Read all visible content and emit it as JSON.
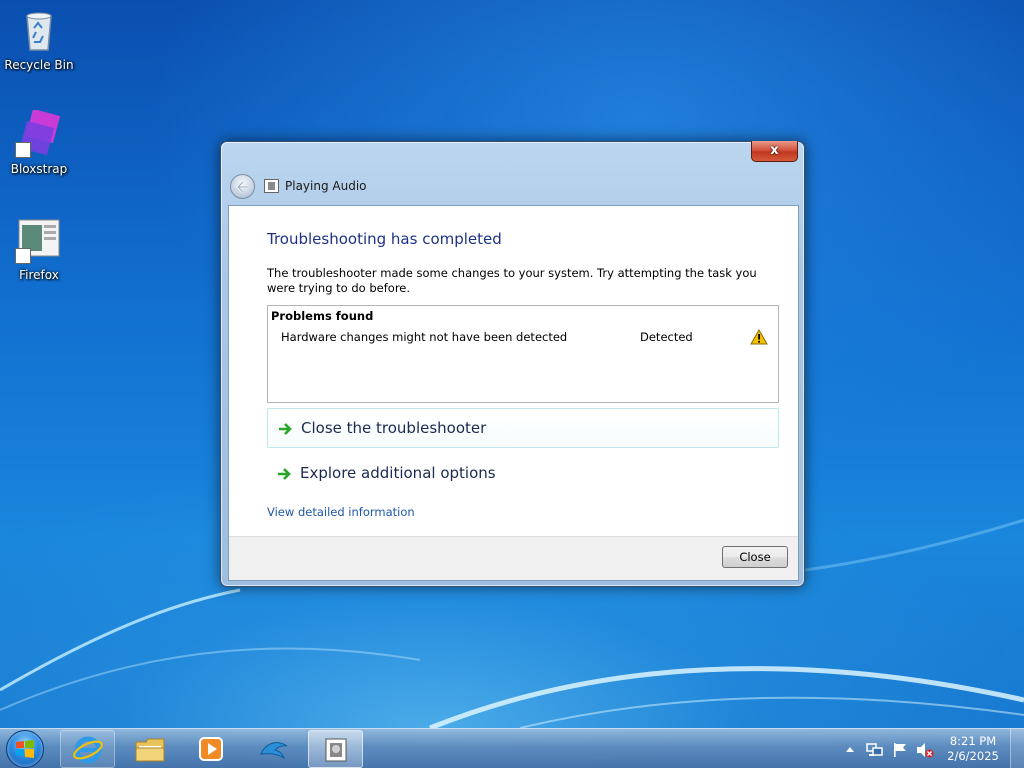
{
  "desktop": {
    "icons": [
      {
        "label": "Recycle Bin",
        "icon": "recycle-bin-icon"
      },
      {
        "label": "Bloxstrap",
        "icon": "bloxstrap-icon"
      },
      {
        "label": "Firefox",
        "icon": "firefox-shortcut-icon"
      }
    ]
  },
  "dialog": {
    "title": "Playing Audio",
    "close_glyph": "x",
    "heading": "Troubleshooting has completed",
    "description": "The troubleshooter made some changes to your system. Try attempting the task you were trying to do before.",
    "problems": {
      "header": "Problems found",
      "rows": [
        {
          "name": "Hardware changes might not have been detected",
          "status": "Detected",
          "icon": "warning-icon"
        }
      ]
    },
    "commands": [
      {
        "label": "Close the troubleshooter",
        "icon": "green-arrow-icon"
      },
      {
        "label": "Explore additional options",
        "icon": "green-arrow-icon"
      }
    ],
    "details_link": "View detailed information",
    "close_button": "Close"
  },
  "taskbar": {
    "pinned": [
      "internet-explorer-icon",
      "windows-explorer-icon",
      "media-player-icon",
      "dolphin-icon"
    ],
    "active_window_icon": "troubleshooter-icon",
    "tray": [
      "show-hidden-icons-arrow",
      "network-icon",
      "action-center-flag-icon",
      "volume-muted-icon"
    ],
    "clock": {
      "time": "8:21 PM",
      "date": "2/6/2025"
    }
  },
  "colors": {
    "heading": "#1e3287",
    "link": "#1e57a6",
    "command_arrow": "#2aa52a",
    "warning": "#f2c200"
  }
}
